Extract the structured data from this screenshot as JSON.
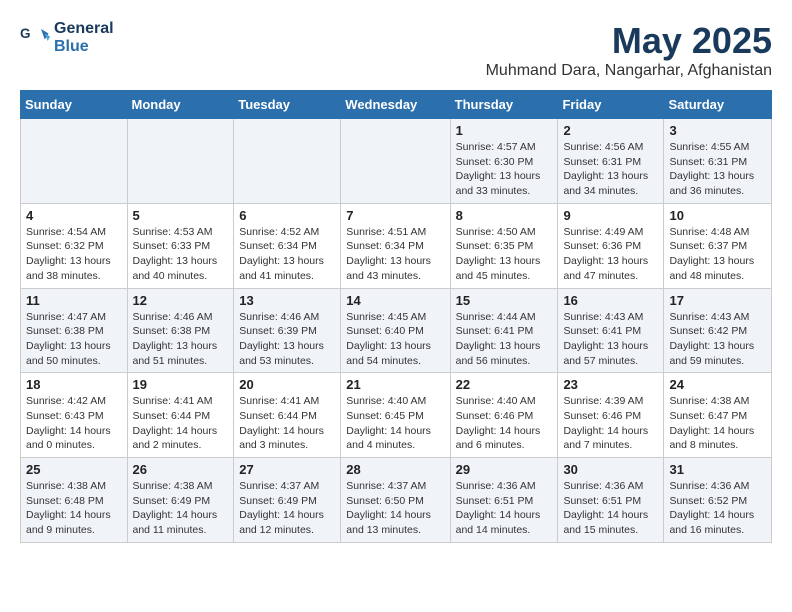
{
  "header": {
    "logo_line1": "General",
    "logo_line2": "Blue",
    "month": "May 2025",
    "location": "Muhmand Dara, Nangarhar, Afghanistan"
  },
  "weekdays": [
    "Sunday",
    "Monday",
    "Tuesday",
    "Wednesday",
    "Thursday",
    "Friday",
    "Saturday"
  ],
  "weeks": [
    [
      {
        "day": "",
        "info": ""
      },
      {
        "day": "",
        "info": ""
      },
      {
        "day": "",
        "info": ""
      },
      {
        "day": "",
        "info": ""
      },
      {
        "day": "1",
        "info": "Sunrise: 4:57 AM\nSunset: 6:30 PM\nDaylight: 13 hours\nand 33 minutes."
      },
      {
        "day": "2",
        "info": "Sunrise: 4:56 AM\nSunset: 6:31 PM\nDaylight: 13 hours\nand 34 minutes."
      },
      {
        "day": "3",
        "info": "Sunrise: 4:55 AM\nSunset: 6:31 PM\nDaylight: 13 hours\nand 36 minutes."
      }
    ],
    [
      {
        "day": "4",
        "info": "Sunrise: 4:54 AM\nSunset: 6:32 PM\nDaylight: 13 hours\nand 38 minutes."
      },
      {
        "day": "5",
        "info": "Sunrise: 4:53 AM\nSunset: 6:33 PM\nDaylight: 13 hours\nand 40 minutes."
      },
      {
        "day": "6",
        "info": "Sunrise: 4:52 AM\nSunset: 6:34 PM\nDaylight: 13 hours\nand 41 minutes."
      },
      {
        "day": "7",
        "info": "Sunrise: 4:51 AM\nSunset: 6:34 PM\nDaylight: 13 hours\nand 43 minutes."
      },
      {
        "day": "8",
        "info": "Sunrise: 4:50 AM\nSunset: 6:35 PM\nDaylight: 13 hours\nand 45 minutes."
      },
      {
        "day": "9",
        "info": "Sunrise: 4:49 AM\nSunset: 6:36 PM\nDaylight: 13 hours\nand 47 minutes."
      },
      {
        "day": "10",
        "info": "Sunrise: 4:48 AM\nSunset: 6:37 PM\nDaylight: 13 hours\nand 48 minutes."
      }
    ],
    [
      {
        "day": "11",
        "info": "Sunrise: 4:47 AM\nSunset: 6:38 PM\nDaylight: 13 hours\nand 50 minutes."
      },
      {
        "day": "12",
        "info": "Sunrise: 4:46 AM\nSunset: 6:38 PM\nDaylight: 13 hours\nand 51 minutes."
      },
      {
        "day": "13",
        "info": "Sunrise: 4:46 AM\nSunset: 6:39 PM\nDaylight: 13 hours\nand 53 minutes."
      },
      {
        "day": "14",
        "info": "Sunrise: 4:45 AM\nSunset: 6:40 PM\nDaylight: 13 hours\nand 54 minutes."
      },
      {
        "day": "15",
        "info": "Sunrise: 4:44 AM\nSunset: 6:41 PM\nDaylight: 13 hours\nand 56 minutes."
      },
      {
        "day": "16",
        "info": "Sunrise: 4:43 AM\nSunset: 6:41 PM\nDaylight: 13 hours\nand 57 minutes."
      },
      {
        "day": "17",
        "info": "Sunrise: 4:43 AM\nSunset: 6:42 PM\nDaylight: 13 hours\nand 59 minutes."
      }
    ],
    [
      {
        "day": "18",
        "info": "Sunrise: 4:42 AM\nSunset: 6:43 PM\nDaylight: 14 hours\nand 0 minutes."
      },
      {
        "day": "19",
        "info": "Sunrise: 4:41 AM\nSunset: 6:44 PM\nDaylight: 14 hours\nand 2 minutes."
      },
      {
        "day": "20",
        "info": "Sunrise: 4:41 AM\nSunset: 6:44 PM\nDaylight: 14 hours\nand 3 minutes."
      },
      {
        "day": "21",
        "info": "Sunrise: 4:40 AM\nSunset: 6:45 PM\nDaylight: 14 hours\nand 4 minutes."
      },
      {
        "day": "22",
        "info": "Sunrise: 4:40 AM\nSunset: 6:46 PM\nDaylight: 14 hours\nand 6 minutes."
      },
      {
        "day": "23",
        "info": "Sunrise: 4:39 AM\nSunset: 6:46 PM\nDaylight: 14 hours\nand 7 minutes."
      },
      {
        "day": "24",
        "info": "Sunrise: 4:38 AM\nSunset: 6:47 PM\nDaylight: 14 hours\nand 8 minutes."
      }
    ],
    [
      {
        "day": "25",
        "info": "Sunrise: 4:38 AM\nSunset: 6:48 PM\nDaylight: 14 hours\nand 9 minutes."
      },
      {
        "day": "26",
        "info": "Sunrise: 4:38 AM\nSunset: 6:49 PM\nDaylight: 14 hours\nand 11 minutes."
      },
      {
        "day": "27",
        "info": "Sunrise: 4:37 AM\nSunset: 6:49 PM\nDaylight: 14 hours\nand 12 minutes."
      },
      {
        "day": "28",
        "info": "Sunrise: 4:37 AM\nSunset: 6:50 PM\nDaylight: 14 hours\nand 13 minutes."
      },
      {
        "day": "29",
        "info": "Sunrise: 4:36 AM\nSunset: 6:51 PM\nDaylight: 14 hours\nand 14 minutes."
      },
      {
        "day": "30",
        "info": "Sunrise: 4:36 AM\nSunset: 6:51 PM\nDaylight: 14 hours\nand 15 minutes."
      },
      {
        "day": "31",
        "info": "Sunrise: 4:36 AM\nSunset: 6:52 PM\nDaylight: 14 hours\nand 16 minutes."
      }
    ]
  ]
}
